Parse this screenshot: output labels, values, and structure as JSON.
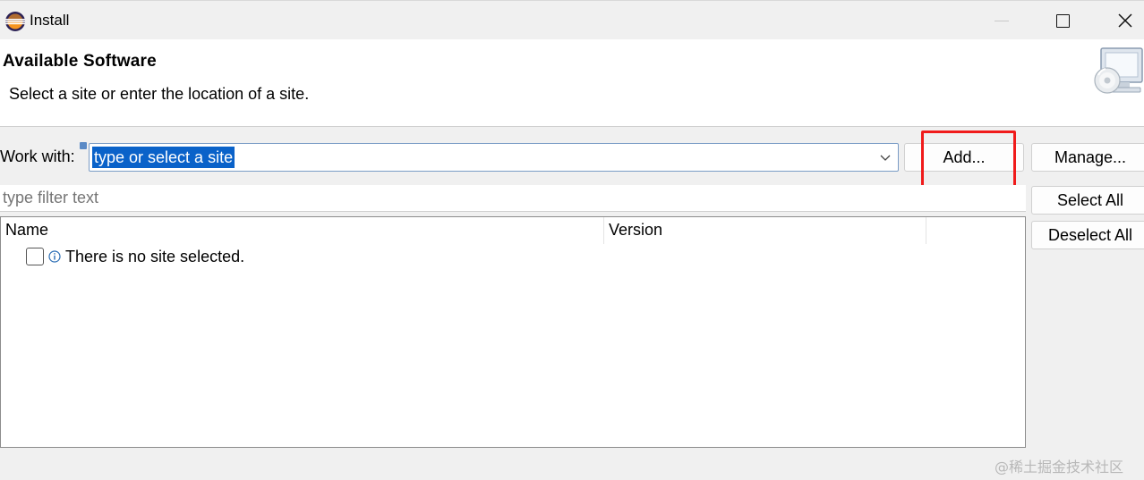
{
  "window": {
    "title": "Install",
    "app_icon": "eclipse-icon",
    "controls": [
      "minimize-icon",
      "maximize-icon",
      "close-icon"
    ]
  },
  "header": {
    "title": "Available Software",
    "description": "Select a site or enter the location of a site.",
    "image": "install-wizard-monitor-icon"
  },
  "work_with": {
    "label": "Work with:",
    "value": "type or select a site",
    "dropdown_icon": "chevron-down-icon"
  },
  "buttons": {
    "add": "Add...",
    "manage": "Manage...",
    "select_all": "Select All",
    "deselect_all": "Deselect All"
  },
  "filter": {
    "placeholder": "type filter text"
  },
  "table": {
    "columns": [
      "Name",
      "Version"
    ],
    "rows": [
      {
        "checked": false,
        "icon": "info-icon",
        "text": "There is no site selected."
      }
    ]
  },
  "annotation": {
    "highlight_color": "#f01b1b",
    "highlighted": "add-button"
  },
  "watermark": "@稀土掘金技术社区",
  "colors": {
    "selection": "#0a62c9",
    "dialog_bg": "#f0f0f0"
  }
}
